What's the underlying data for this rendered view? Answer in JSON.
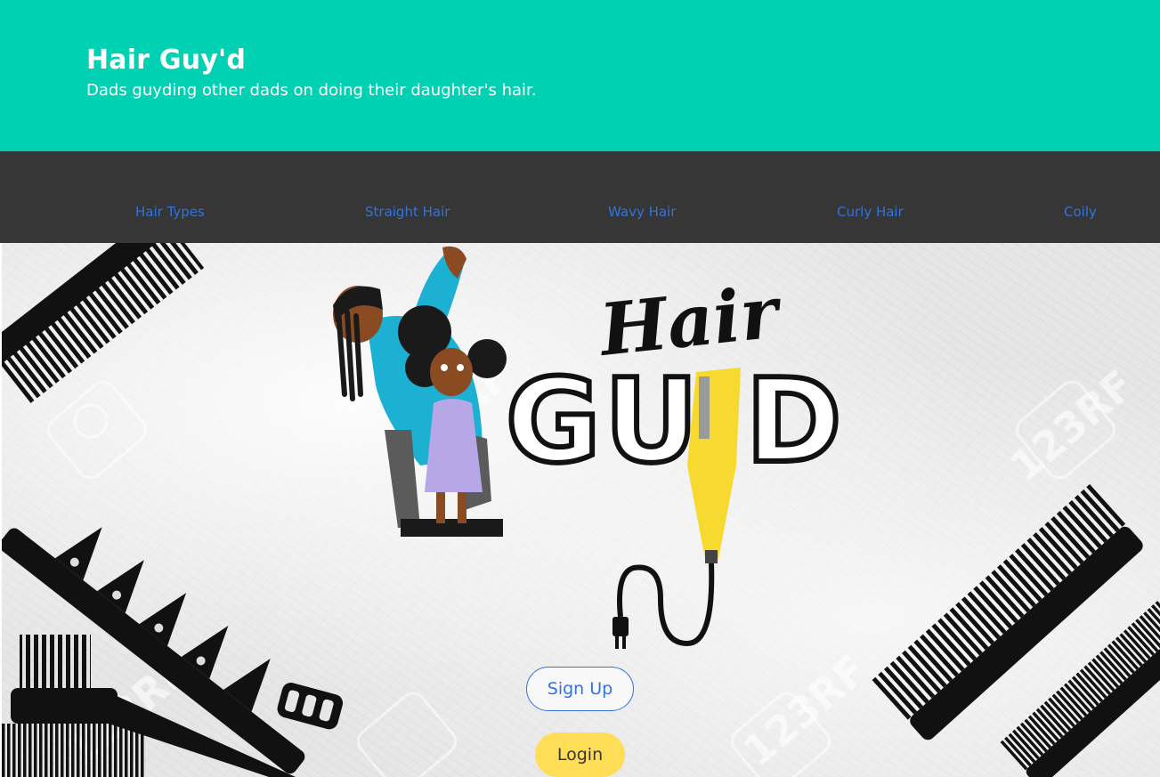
{
  "header": {
    "title": "Hair Guy'd",
    "subtitle": "Dads guyding other dads on doing their daughter's hair."
  },
  "nav": {
    "items": [
      {
        "label": "Hair Types"
      },
      {
        "label": "Straight Hair"
      },
      {
        "label": "Wavy Hair"
      },
      {
        "label": "Curly Hair"
      },
      {
        "label": "Coily"
      }
    ]
  },
  "hero": {
    "logo_script": "Hair",
    "logo_outline": "GU D",
    "watermark": "123RF"
  },
  "buttons": {
    "signup_label": "Sign Up",
    "login_label": "Login"
  },
  "colors": {
    "header_bg": "#00d1b2",
    "nav_bg": "#363636",
    "link": "#3273dc",
    "login_bg": "#ffdd57"
  }
}
